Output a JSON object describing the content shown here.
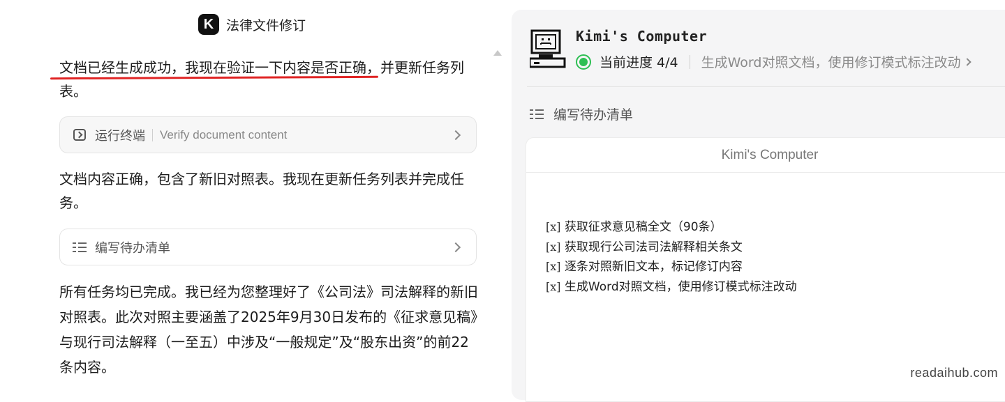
{
  "chat": {
    "title": "法律文件修订",
    "logo_letter": "K",
    "message1_highlight": "文档已经生成成功，我现在验证一下内容是否正确",
    "message1_rest": "，并更新任务列表。",
    "tool_call1": {
      "name": "运行终端",
      "description": "Verify document content",
      "icon": "terminal-icon"
    },
    "message2": "文档内容正确，包含了新旧对照表。我现在更新任务列表并完成任务。",
    "tool_call2": {
      "name": "编写待办清单",
      "icon": "checklist-icon"
    },
    "message3": "所有任务均已完成。我已经为您整理好了《公司法》司法解释的新旧对照表。此次对照主要涵盖了2025年9月30日发布的《征求意见稿》与现行司法解释（一至五）中涉及“一般规定”及“股东出资”的前22条内容。"
  },
  "computer": {
    "title": "Kimi's Computer",
    "progress_label": "当前进度 4/4",
    "progress_fraction": 1.0,
    "current_task": "生成Word对照文档，使用修订模式标注改动",
    "section_label": "编写待办清单",
    "window_title": "Kimi's Computer",
    "todos": [
      {
        "box": "[x]",
        "text": "获取征求意见稿全文（90条）"
      },
      {
        "box": "[x]",
        "text": "获取现行公司法司法解释相关条文"
      },
      {
        "box": "[x]",
        "text": "逐条对照新旧文本，标记修订内容"
      },
      {
        "box": "[x]",
        "text": "生成Word对照文档，使用修订模式标注改动"
      }
    ]
  },
  "colors": {
    "accent_green": "#2fbf54",
    "underline_red": "#e02424"
  },
  "watermark": "readaihub.com"
}
